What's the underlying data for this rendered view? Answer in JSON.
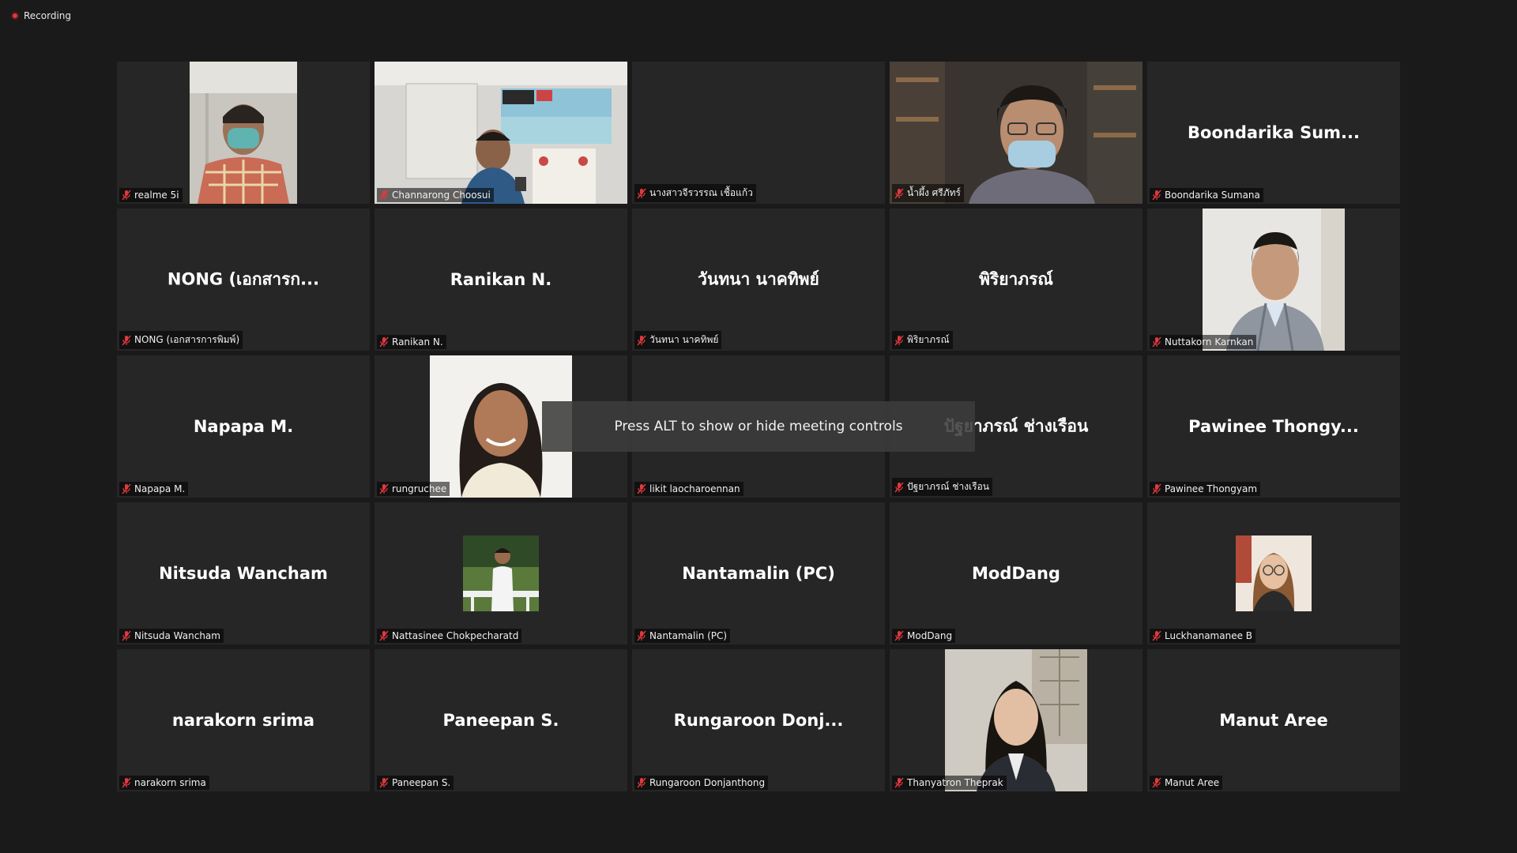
{
  "recording": {
    "label": "Recording"
  },
  "toast": {
    "text": "Press ALT to show or hide meeting controls"
  },
  "participants": [
    {
      "label": "realme 5i",
      "big": "",
      "video": true
    },
    {
      "label": "Channarong Choosui",
      "big": "",
      "video": true
    },
    {
      "label": "นางสาวจีรวรรณ เชื้อแก้ว",
      "big": "",
      "video": false
    },
    {
      "label": "น้ำผึ้ง ศรีภัทร์",
      "big": "",
      "video": true
    },
    {
      "label": "Boondarika Sumana",
      "big": "Boondarika  Sum...",
      "video": false
    },
    {
      "label": "NONG (เอกสารการพิมพ์)",
      "big": "NONG  (เอกสารก...",
      "video": false
    },
    {
      "label": "Ranikan N.",
      "big": "Ranikan N.",
      "video": false
    },
    {
      "label": "วันทนา นาคทิพย์",
      "big": "วันทนา นาคทิพย์",
      "video": false
    },
    {
      "label": "พิริยาภรณ์",
      "big": "พิริยาภรณ์",
      "video": false
    },
    {
      "label": "Nuttakorn Karnkan",
      "big": "",
      "video": true
    },
    {
      "label": "Napapa M.",
      "big": "Napapa M.",
      "video": false
    },
    {
      "label": "rungruchee",
      "big": "",
      "video": true
    },
    {
      "label": "likit laocharoennan",
      "big": "",
      "video": false
    },
    {
      "label": "ปัฐยาภรณ์ ช่างเรือน",
      "big": "ปัฐยาภรณ์  ช่างเรือน",
      "video": false
    },
    {
      "label": "Pawinee Thongyam",
      "big": "Pawinee  Thongy...",
      "video": false
    },
    {
      "label": "Nitsuda Wancham",
      "big": "Nitsuda Wancham",
      "video": false
    },
    {
      "label": "Nattasinee Chokpecharatd",
      "big": "",
      "video": true
    },
    {
      "label": "Nantamalin (PC)",
      "big": "Nantamalin (PC)",
      "video": false
    },
    {
      "label": "ModDang",
      "big": "ModDang",
      "video": false
    },
    {
      "label": "Luckhanamanee B",
      "big": "",
      "video": true
    },
    {
      "label": "narakorn srima",
      "big": "narakorn srima",
      "video": false
    },
    {
      "label": "Paneepan S.",
      "big": "Paneepan S.",
      "video": false
    },
    {
      "label": "Rungaroon Donjanthong",
      "big": "Rungaroon  Donj...",
      "video": false
    },
    {
      "label": "Thanyatron Theprak",
      "big": "",
      "video": true
    },
    {
      "label": "Manut Aree",
      "big": "Manut Aree",
      "video": false
    }
  ]
}
